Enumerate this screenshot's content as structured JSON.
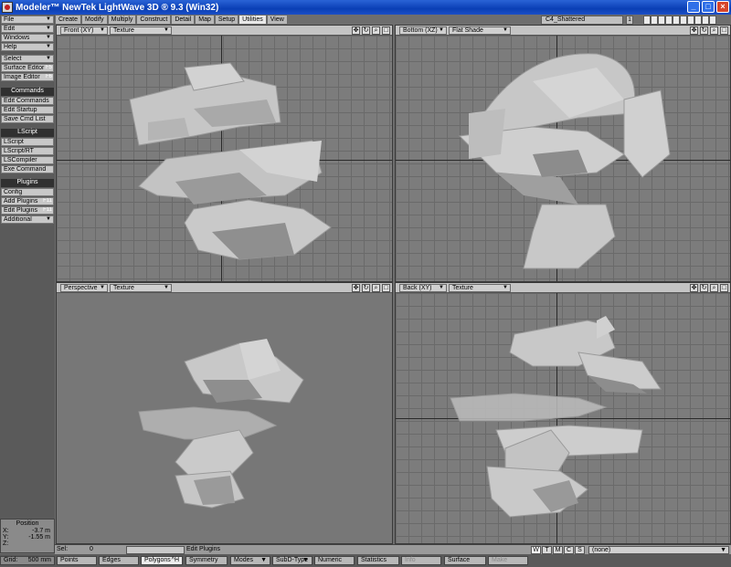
{
  "window": {
    "title": "Modeler™ NewTek LightWave 3D ® 9.3 (Win32)",
    "buttons": [
      "_",
      "□",
      "×"
    ]
  },
  "sidebar": {
    "menus": [
      {
        "label": "File",
        "y": 17
      },
      {
        "label": "Edit",
        "y": 27
      },
      {
        "label": "Windows",
        "y": 37
      },
      {
        "label": "Help",
        "y": 47
      }
    ],
    "tools1": [
      {
        "label": "Select",
        "arrow": "▼"
      },
      {
        "label": "Surface Editor",
        "key": "F5"
      },
      {
        "label": "Image Editor",
        "key": "F6"
      }
    ],
    "commands_head": "Commands",
    "commands": [
      "Edit Commands",
      "Edit Startup",
      "Save Cmd List"
    ],
    "lscript_head": "LScript",
    "lscript": [
      "LScript",
      "LScript/RT",
      "LSCompiler",
      "Exe Command"
    ],
    "plugins_head": "Plugins",
    "plugins": [
      {
        "label": "Config"
      },
      {
        "label": "Add Plugins",
        "key": "F11"
      },
      {
        "label": "Edit Plugins",
        "key": "F11"
      },
      {
        "label": "Additional",
        "arrow": "▼"
      }
    ]
  },
  "tabs": [
    "Create",
    "Modify",
    "Multiply",
    "Construct",
    "Detail",
    "Map",
    "Setup",
    "Utilities",
    "View"
  ],
  "active_tab": "Utilities",
  "object": {
    "name": "C4_Shattered",
    "layer": "1"
  },
  "viewports": [
    {
      "name": "Front",
      "axes": "(XY)",
      "shading": "Texture"
    },
    {
      "name": "Bottom",
      "axes": "(XZ)",
      "shading": "Flat Shade"
    },
    {
      "name": "Perspective",
      "axes": "",
      "shading": "Texture"
    },
    {
      "name": "Back",
      "axes": "(XY)",
      "shading": "Texture"
    }
  ],
  "position": {
    "title": "Position",
    "x_label": "X:",
    "x": "-3.7 m",
    "y_label": "Y:",
    "y": "-1.55 m",
    "z_label": "Z:",
    "z": ""
  },
  "status": {
    "sel_label": "Sel:",
    "sel_value": "0",
    "message": "Edit Plugins",
    "wtmcs": [
      "W",
      "T",
      "M",
      "C",
      "S"
    ],
    "surface": "(none)"
  },
  "bottom": {
    "grid_label": "Grid:",
    "grid_value": "500 mm",
    "points": "Points",
    "edges": "Edges",
    "polygons": "Polygons",
    "polygons_key": "^H",
    "symmetry": "Symmetry",
    "modes": "Modes",
    "subd": "SubD-Type",
    "numeric": "Numeric",
    "statistics": "Statistics",
    "info": "Info",
    "surface": "Surface",
    "make": "Make"
  },
  "colors": {
    "titlebar": "#0a3fb5",
    "viewport_bg": "#7c7c7c",
    "mesh_light": "#c9c9c9",
    "mesh_dark": "#8a8a8a"
  }
}
